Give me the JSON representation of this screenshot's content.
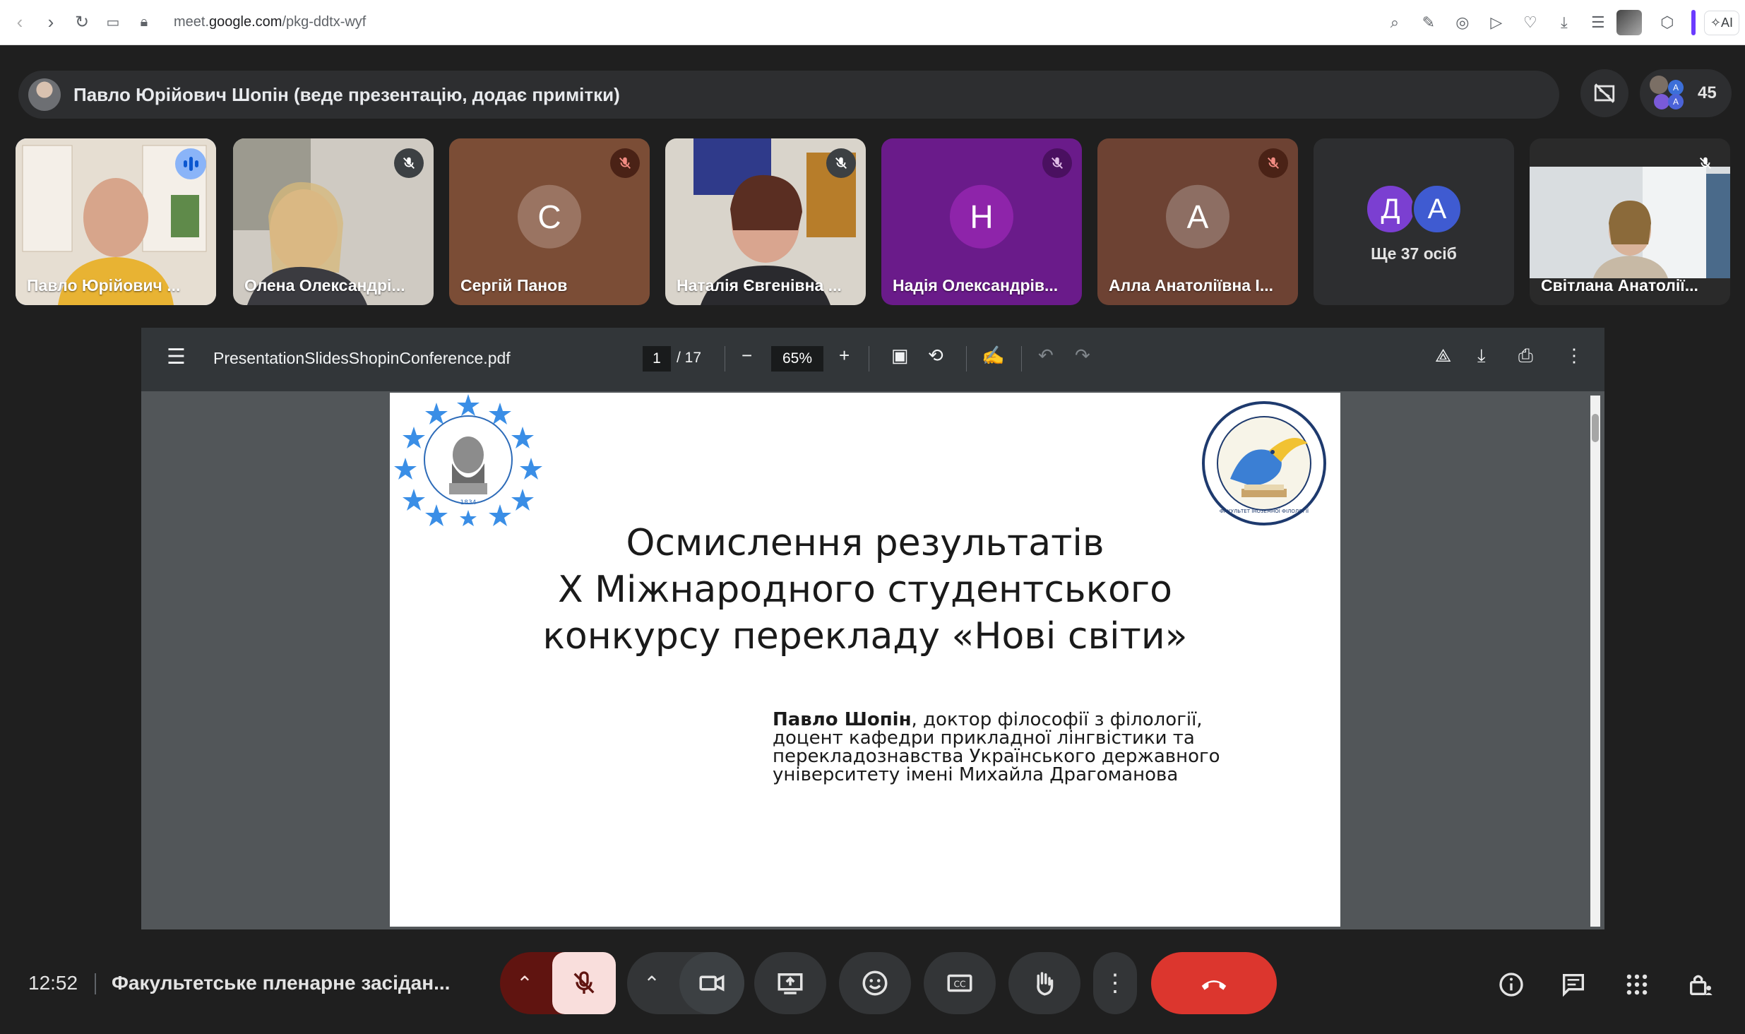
{
  "browser": {
    "url_prefix": "meet.",
    "url_domain": "google.com",
    "url_path": "/pkg-ddtx-wyf",
    "ai_label": "AI"
  },
  "presenter_banner": {
    "text": "Павло Юрійович Шопін (веде презентацію, додає примітки)"
  },
  "people_count": "45",
  "mini_avatars": [
    "A",
    "A"
  ],
  "tiles": [
    {
      "name": "Павло Юрійович ...",
      "type": "video",
      "speaking": true
    },
    {
      "name": "Олена Олександрі...",
      "type": "video",
      "muted": true
    },
    {
      "name": "Сергій Панов",
      "type": "letter",
      "letter": "С",
      "bg": "#7b4d36",
      "circle": "#9a7462",
      "muted": true
    },
    {
      "name": "Наталія Євгенівна ...",
      "type": "video",
      "muted": true
    },
    {
      "name": "Надія Олександрів...",
      "type": "letter",
      "letter": "Н",
      "bg": "#6a1b8a",
      "circle": "#8e24aa",
      "muted": true
    },
    {
      "name": "Алла Анатоліївна І...",
      "type": "letter",
      "letter": "А",
      "bg": "#6d4233",
      "circle": "#8d6e63",
      "muted": true
    },
    {
      "name": "Ще 37 осіб",
      "type": "more",
      "letters": [
        "Д",
        "А"
      ]
    },
    {
      "name": "Світлана Анатолії...",
      "type": "video",
      "muted": true
    }
  ],
  "pdf": {
    "filename": "PresentationSlidesShopinConference.pdf",
    "current_page": "1",
    "total_pages": "/ 17",
    "zoom": "65%"
  },
  "slide": {
    "title_line1": "Осмислення результатів",
    "title_line2": "X Міжнародного студентського",
    "title_line3": "конкурсу перекладу «Нові світи»",
    "author_name": "Павло Шопін",
    "author_line1": ", доктор філософії з філології,",
    "author_line2": "доцент кафедри прикладної лінгвістики та",
    "author_line3": "перекладознавства Українського державного",
    "author_line4": "університету імені Михайла Драгоманова",
    "logo_left_year": "1834",
    "logo_right_caption": "ФАКУЛЬТЕТ ІНОЗЕМНОЇ ФІЛОЛОГІЇ"
  },
  "bottom": {
    "time": "12:52",
    "meeting_name": "Факультетське пленарне засідан..."
  },
  "colors": {
    "leave_red": "#dc362e",
    "mic_off_bg": "#f9dedc",
    "mic_dark_red": "#601410",
    "active_outline": "#a8c7fa"
  }
}
